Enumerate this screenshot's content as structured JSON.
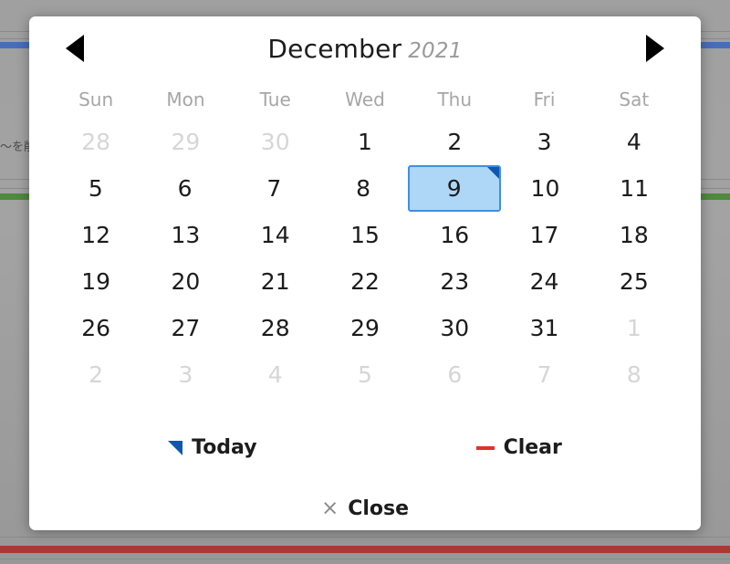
{
  "background": {
    "partial_text": "〜を削",
    "colors": {
      "page": "#a0a0a0",
      "blue_bar": "#4470b8",
      "green_bar": "#4f8a3d",
      "red_bar": "#a83a35"
    }
  },
  "dialog": {
    "header": {
      "prev_icon": "triangle-left-icon",
      "next_icon": "triangle-right-icon",
      "month": "December",
      "year": "2021"
    },
    "weekdays": [
      "Sun",
      "Mon",
      "Tue",
      "Wed",
      "Thu",
      "Fri",
      "Sat"
    ],
    "weeks": [
      [
        {
          "day": "28",
          "state": "muted"
        },
        {
          "day": "29",
          "state": "muted"
        },
        {
          "day": "30",
          "state": "muted"
        },
        {
          "day": "1",
          "state": "current"
        },
        {
          "day": "2",
          "state": "current"
        },
        {
          "day": "3",
          "state": "current"
        },
        {
          "day": "4",
          "state": "current"
        }
      ],
      [
        {
          "day": "5",
          "state": "current"
        },
        {
          "day": "6",
          "state": "current"
        },
        {
          "day": "7",
          "state": "current"
        },
        {
          "day": "8",
          "state": "current"
        },
        {
          "day": "9",
          "state": "selected"
        },
        {
          "day": "10",
          "state": "current"
        },
        {
          "day": "11",
          "state": "current"
        }
      ],
      [
        {
          "day": "12",
          "state": "current"
        },
        {
          "day": "13",
          "state": "current"
        },
        {
          "day": "14",
          "state": "current"
        },
        {
          "day": "15",
          "state": "current"
        },
        {
          "day": "16",
          "state": "current"
        },
        {
          "day": "17",
          "state": "current"
        },
        {
          "day": "18",
          "state": "current"
        }
      ],
      [
        {
          "day": "19",
          "state": "current"
        },
        {
          "day": "20",
          "state": "current"
        },
        {
          "day": "21",
          "state": "current"
        },
        {
          "day": "22",
          "state": "current"
        },
        {
          "day": "23",
          "state": "current"
        },
        {
          "day": "24",
          "state": "current"
        },
        {
          "day": "25",
          "state": "current"
        }
      ],
      [
        {
          "day": "26",
          "state": "current"
        },
        {
          "day": "27",
          "state": "current"
        },
        {
          "day": "28",
          "state": "current"
        },
        {
          "day": "29",
          "state": "current"
        },
        {
          "day": "30",
          "state": "current"
        },
        {
          "day": "31",
          "state": "current"
        },
        {
          "day": "1",
          "state": "muted"
        }
      ],
      [
        {
          "day": "2",
          "state": "muted"
        },
        {
          "day": "3",
          "state": "muted"
        },
        {
          "day": "4",
          "state": "muted"
        },
        {
          "day": "5",
          "state": "muted"
        },
        {
          "day": "6",
          "state": "muted"
        },
        {
          "day": "7",
          "state": "muted"
        },
        {
          "day": "8",
          "state": "muted"
        }
      ]
    ],
    "selected_day": "9",
    "footer": {
      "today_label": "Today",
      "today_icon": "triangle-corner-icon",
      "clear_label": "Clear",
      "clear_icon": "minus-icon",
      "close_label": "Close",
      "close_icon": "close-x-icon",
      "close_glyph": "×"
    },
    "colors": {
      "selected_fill": "#aed6f7",
      "selected_border": "#3f90e0",
      "marker_blue": "#1157b0",
      "clear_red": "#e03127"
    }
  }
}
